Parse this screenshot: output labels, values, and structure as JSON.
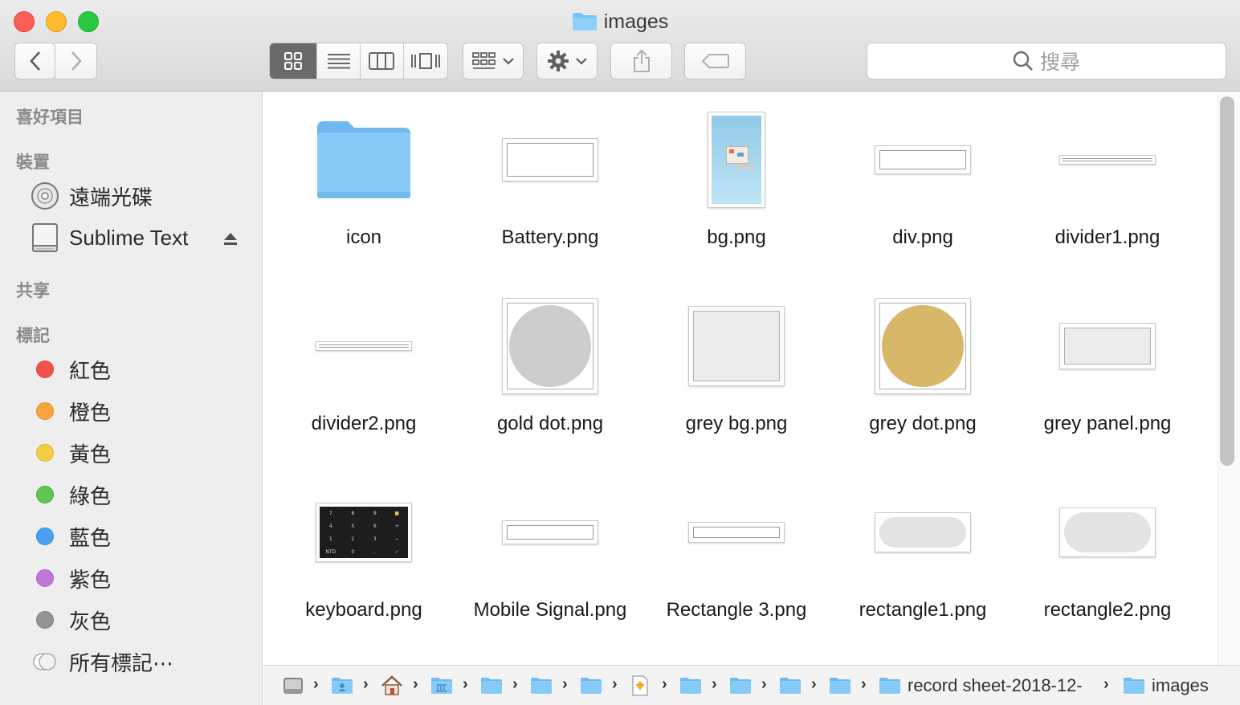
{
  "window": {
    "title": "images"
  },
  "toolbar": {
    "back_icon": "chevron-left-icon",
    "forward_icon": "chevron-right-icon",
    "views": [
      "icon-view",
      "list-view",
      "column-view",
      "cover-flow-view"
    ],
    "active_view": "icon-view",
    "search_placeholder": "搜尋"
  },
  "sidebar": {
    "favorites_header": "喜好項目",
    "devices_header": "裝置",
    "devices": [
      {
        "label": "遠端光碟",
        "icon": "optical-disc-icon"
      },
      {
        "label": "Sublime Text",
        "icon": "external-drive-icon"
      }
    ],
    "shared_header": "共享",
    "tags_header": "標記",
    "tags": [
      {
        "label": "紅色",
        "color": "#f0524a"
      },
      {
        "label": "橙色",
        "color": "#f7a43f"
      },
      {
        "label": "黃色",
        "color": "#f4cd47"
      },
      {
        "label": "綠色",
        "color": "#5ec651"
      },
      {
        "label": "藍色",
        "color": "#4aa0f1"
      },
      {
        "label": "紫色",
        "color": "#c179d9"
      },
      {
        "label": "灰色",
        "color": "#939393"
      },
      {
        "label": "所有標記⋯",
        "color": ""
      }
    ]
  },
  "files": [
    {
      "name": "icon",
      "kind": "folder"
    },
    {
      "name": "Battery.png",
      "kind": "wide-rect"
    },
    {
      "name": "bg.png",
      "kind": "phone-bg"
    },
    {
      "name": "div.png",
      "kind": "thin-rect"
    },
    {
      "name": "divider1.png",
      "kind": "line"
    },
    {
      "name": "divider2.png",
      "kind": "line"
    },
    {
      "name": "gold dot.png",
      "kind": "grey-circle"
    },
    {
      "name": "grey bg.png",
      "kind": "grey-square"
    },
    {
      "name": "grey dot.png",
      "kind": "gold-circle"
    },
    {
      "name": "grey panel.png",
      "kind": "grey-panel"
    },
    {
      "name": "keyboard.png",
      "kind": "keyboard"
    },
    {
      "name": "Mobile Signal.png",
      "kind": "thin-rect"
    },
    {
      "name": "Rectangle 3.png",
      "kind": "thin-rect"
    },
    {
      "name": "rectangle1.png",
      "kind": "pill"
    },
    {
      "name": "rectangle2.png",
      "kind": "pill-tall"
    }
  ],
  "keyboard_keys": [
    "7",
    "8",
    "9",
    "■",
    "4",
    "5",
    "6",
    "+",
    "1",
    "2",
    "3",
    "−",
    "NTD",
    "0",
    ".",
    "✓"
  ],
  "pathbar": {
    "icons": [
      "hard-drive-icon",
      "user-folder-icon",
      "home-icon",
      "library-folder-icon",
      "folder-icon",
      "folder-icon",
      "folder-icon",
      "sketch-file-icon",
      "folder-icon",
      "folder-icon",
      "folder-icon",
      "folder-icon"
    ],
    "folder_label": "record sheet-2018-12-",
    "current_label": "images"
  }
}
